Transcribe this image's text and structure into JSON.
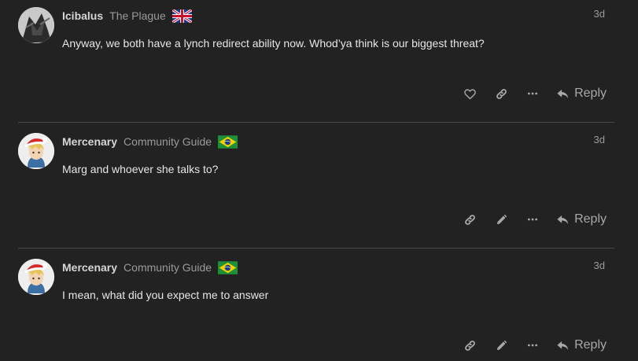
{
  "posts": [
    {
      "username": "Icibalus",
      "user_title": "The Plague",
      "flag": "uk-flag-icon",
      "date": "3d",
      "body": "Anyway, we both have a lynch redirect ability now. Whod’ya think is our biggest threat?",
      "actions": [
        "like-icon",
        "link-icon",
        "more-icon"
      ],
      "reply_label": "Reply"
    },
    {
      "username": "Mercenary",
      "user_title": "Community Guide",
      "flag": "brazil-flag-icon",
      "date": "3d",
      "body": "Marg and whoever she talks to?",
      "actions": [
        "link-icon",
        "edit-icon",
        "more-icon"
      ],
      "reply_label": "Reply"
    },
    {
      "username": "Mercenary",
      "user_title": "Community Guide",
      "flag": "brazil-flag-icon",
      "date": "3d",
      "body": "I mean, what did you expect me to answer",
      "actions": [
        "link-icon",
        "edit-icon",
        "more-icon"
      ],
      "reply_label": "Reply"
    }
  ],
  "colors": {
    "background": "#222222",
    "username": "#d6d6d6",
    "muted": "#9a9a9a",
    "icon": "#a8a8a8",
    "divider": "#4a4a4a"
  }
}
